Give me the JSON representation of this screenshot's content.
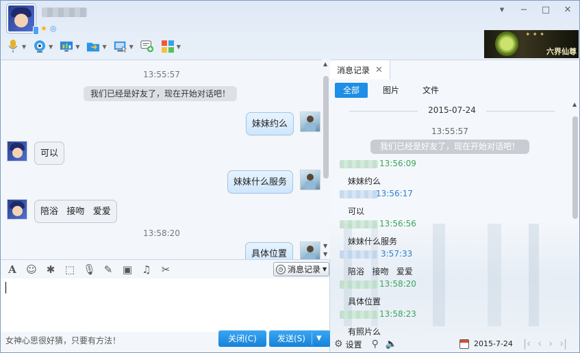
{
  "window": {
    "min": "▾",
    "minimize": "−",
    "maximize": "□",
    "close": "✕"
  },
  "toolbar": {
    "items": [
      "mic",
      "camera",
      "screen",
      "folder",
      "remote",
      "add-message",
      "apps"
    ]
  },
  "ad": {
    "text": "六界仙尊"
  },
  "chat": {
    "ts1": "13:55:57",
    "system": "我们已经是好友了，现在开始对话吧！",
    "m1": "妹妹约么",
    "m2": "可以",
    "m3": "妹妹什么服务",
    "m4": "陪浴   接吻   爱爱",
    "ts2": "13:58:20",
    "m5": "具体位置"
  },
  "input": {
    "history_label": "消息记录",
    "hint": "女神心思很好猜，只要有方法！",
    "close_label": "关闭(C)",
    "send_label": "发送(S)"
  },
  "history": {
    "tab_label": "消息记录",
    "filters": [
      "全部",
      "图片",
      "文件"
    ],
    "date": "2015-07-24",
    "ts": "13:55:57",
    "system": "我们已经是好友了，现在开始对话吧！",
    "entries": [
      {
        "time": "13:56:09",
        "msg": "妹妹约么"
      },
      {
        "time": "13:56:17",
        "msg": "可以"
      },
      {
        "time": "13:56:56",
        "msg": "妹妹什么服务"
      },
      {
        "time": "3:57:33",
        "msg": "陪浴   接吻   爱爱"
      },
      {
        "time": "13:58:20",
        "msg": "具体位置"
      },
      {
        "time": "13:58:23",
        "msg": "有照片么"
      }
    ],
    "settings_label": "设置",
    "date_field": "2015-7-24"
  }
}
